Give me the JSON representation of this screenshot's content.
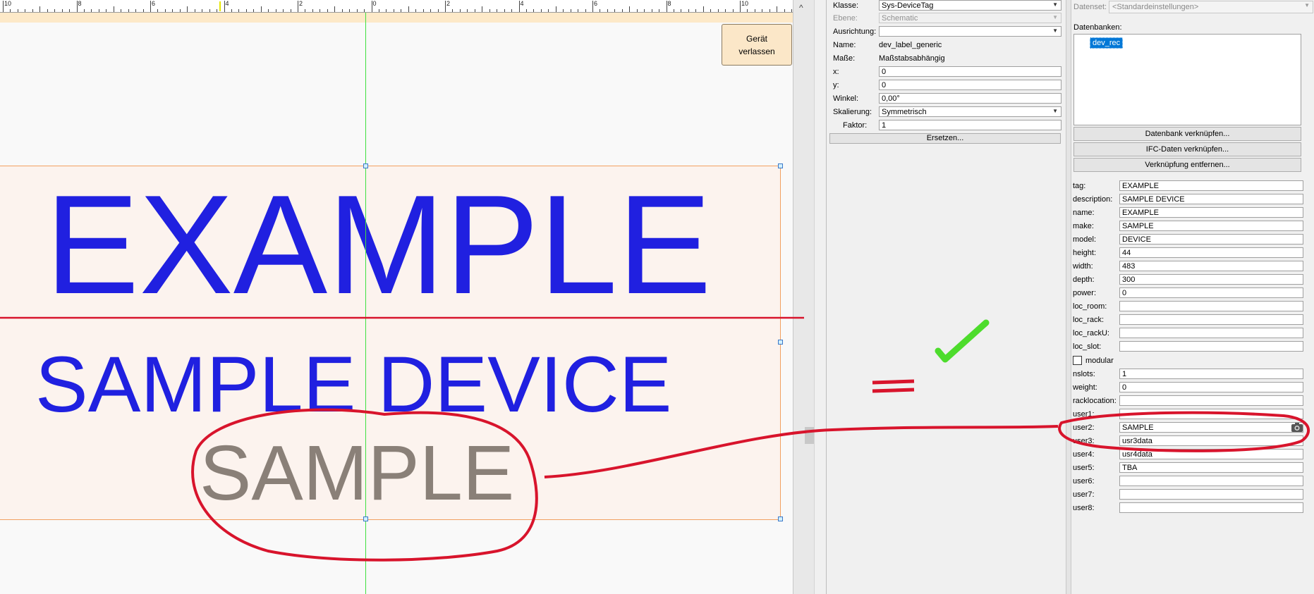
{
  "canvas": {
    "ruler_labels": [
      "10",
      "8",
      "6",
      "4",
      "2",
      "0",
      "2",
      "4",
      "6",
      "8",
      "10"
    ],
    "exit_button_label": "Gerät verlassen",
    "label_tag": "EXAMPLE",
    "label_description": "SAMPLE DEVICE",
    "label_make": "SAMPLE"
  },
  "properties": {
    "class_label": "Klasse:",
    "class_value": "Sys-DeviceTag",
    "layer_label": "Ebene:",
    "layer_value": "Schematic",
    "alignment_label": "Ausrichtung:",
    "alignment_value": "",
    "name_label": "Name:",
    "name_value": "dev_label_generic",
    "dimensions_label": "Maße:",
    "dimensions_value": "Maßstabsabhängig",
    "x_label": "x:",
    "x_value": "0",
    "y_label": "y:",
    "y_value": "0",
    "angle_label": "Winkel:",
    "angle_value": "0,00°",
    "scaling_label": "Skalierung:",
    "scaling_value": "Symmetrisch",
    "factor_label": "Faktor:",
    "factor_value": "1",
    "replace_button": "Ersetzen..."
  },
  "database": {
    "dataset_label": "Datenset:",
    "dataset_value": "<Standardeinstellungen>",
    "databases_label": "Datenbanken:",
    "database_item": "dev_rec",
    "link_db_button": "Datenbank verknüpfen...",
    "link_ifc_button": "IFC-Daten verknüpfen...",
    "remove_link_button": "Verknüpfung entfernen...",
    "modular_label": "modular",
    "fields_top": [
      {
        "label": "tag:",
        "value": "EXAMPLE"
      },
      {
        "label": "description:",
        "value": "SAMPLE DEVICE"
      },
      {
        "label": "name:",
        "value": "EXAMPLE"
      },
      {
        "label": "make:",
        "value": "SAMPLE"
      },
      {
        "label": "model:",
        "value": "DEVICE"
      },
      {
        "label": "height:",
        "value": "44"
      },
      {
        "label": "width:",
        "value": "483"
      },
      {
        "label": "depth:",
        "value": "300"
      },
      {
        "label": "power:",
        "value": "0"
      },
      {
        "label": "loc_room:",
        "value": ""
      },
      {
        "label": "loc_rack:",
        "value": ""
      },
      {
        "label": "loc_rackU:",
        "value": ""
      },
      {
        "label": "loc_slot:",
        "value": ""
      }
    ],
    "fields_bottom": [
      {
        "label": "nslots:",
        "value": "1"
      },
      {
        "label": "weight:",
        "value": "0"
      },
      {
        "label": "racklocation:",
        "value": ""
      },
      {
        "label": "user1:",
        "value": ""
      },
      {
        "label": "user2:",
        "value": "SAMPLE"
      },
      {
        "label": "user3:",
        "value": "usr3data"
      },
      {
        "label": "user4:",
        "value": "usr4data"
      },
      {
        "label": "user5:",
        "value": "TBA"
      },
      {
        "label": "user6:",
        "value": ""
      },
      {
        "label": "user7:",
        "value": ""
      },
      {
        "label": "user8:",
        "value": ""
      }
    ]
  },
  "annotation_colors": {
    "red_marker": "#d8142c",
    "green_check": "#4ddc2c"
  }
}
